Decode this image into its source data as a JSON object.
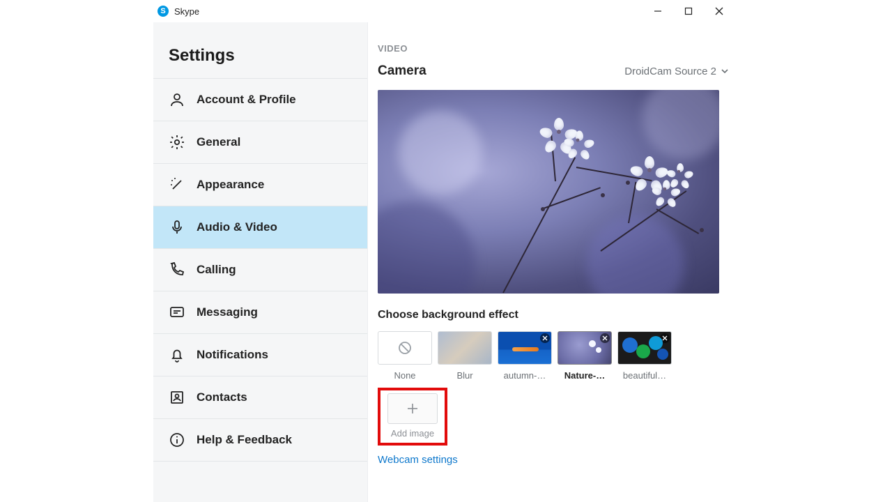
{
  "app": {
    "title": "Skype"
  },
  "sidebar": {
    "heading": "Settings",
    "items": [
      {
        "label": "Account & Profile"
      },
      {
        "label": "General"
      },
      {
        "label": "Appearance"
      },
      {
        "label": "Audio & Video"
      },
      {
        "label": "Calling"
      },
      {
        "label": "Messaging"
      },
      {
        "label": "Notifications"
      },
      {
        "label": "Contacts"
      },
      {
        "label": "Help & Feedback"
      }
    ]
  },
  "main": {
    "section": "VIDEO",
    "camera_label": "Camera",
    "camera_selected": "DroidCam Source 2",
    "bg_label": "Choose background effect",
    "bg_items": [
      {
        "caption": "None"
      },
      {
        "caption": "Blur"
      },
      {
        "caption": "autumn-…"
      },
      {
        "caption": "Nature-…"
      },
      {
        "caption": "beautiful…"
      }
    ],
    "add_image": "Add image",
    "webcam_settings": "Webcam settings"
  }
}
